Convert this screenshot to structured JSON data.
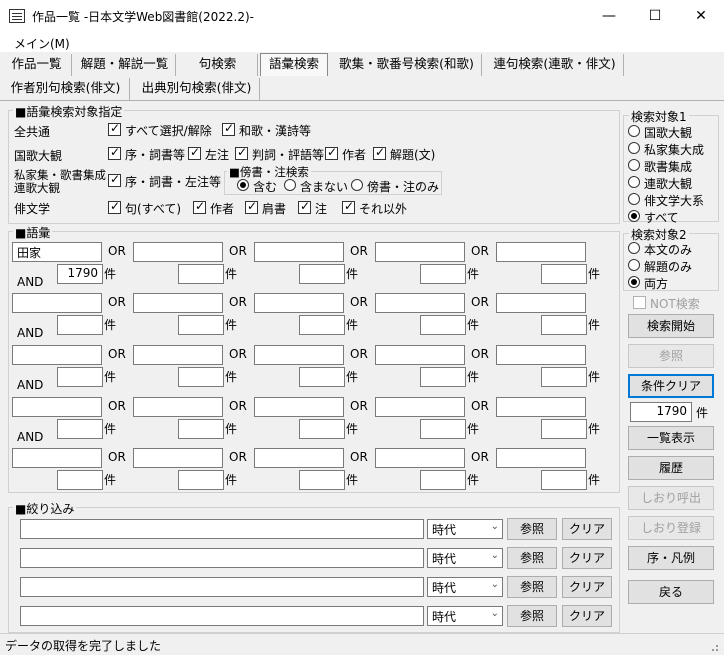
{
  "window": {
    "title": "作品一覧 -日本文学Web図書館(2022.2)-",
    "minimize": "—",
    "maximize": "☐",
    "close": "✕"
  },
  "menu": {
    "main": "メイン(M)"
  },
  "tabs": [
    {
      "label": "作品一覧"
    },
    {
      "label": "解題・解説一覧"
    },
    {
      "label": "句検索"
    },
    {
      "label": "語彙検索"
    },
    {
      "label": "歌集・歌番号検索(和歌)"
    },
    {
      "label": "連句検索(連歌・俳文)"
    },
    {
      "label": "作者別句検索(俳文)"
    },
    {
      "label": "出典別句検索(俳文)"
    }
  ],
  "target_group": {
    "title": "■語彙検索対象指定",
    "rows": [
      {
        "label": "全共通",
        "checks": [
          {
            "label": "すべて選択/解除",
            "checked": true
          },
          {
            "label": "和歌・漢詩等",
            "checked": true
          }
        ]
      },
      {
        "label": "国歌大観",
        "checks": [
          {
            "label": "序・詞書等",
            "checked": true
          },
          {
            "label": "左注",
            "checked": true
          },
          {
            "label": "判詞・評語等",
            "checked": true
          },
          {
            "label": "作者",
            "checked": true
          },
          {
            "label": "解題(文)",
            "checked": true
          }
        ]
      },
      {
        "label_line1": "私家集・歌書集成",
        "label_line2": "連歌大観",
        "checks": [
          {
            "label": "序・詞書・左注等",
            "checked": true
          }
        ]
      },
      {
        "label": "俳文学",
        "checks": [
          {
            "label": "句(すべて)",
            "checked": true
          },
          {
            "label": "作者",
            "checked": true
          },
          {
            "label": "肩書",
            "checked": true
          },
          {
            "label": "注",
            "checked": true
          },
          {
            "label": "それ以外",
            "checked": true
          }
        ]
      }
    ],
    "side_note": {
      "title": "■傍書・注検索",
      "options": [
        {
          "label": "含む",
          "selected": true
        },
        {
          "label": "含まない",
          "selected": false
        },
        {
          "label": "傍書・注のみ",
          "selected": false
        }
      ]
    }
  },
  "vocab_group": {
    "title": "■語彙",
    "or_label": "OR",
    "and_label": "AND",
    "count_unit": "件",
    "rows": [
      {
        "terms": [
          "田家",
          "",
          "",
          "",
          ""
        ],
        "counts": [
          "1790",
          "",
          "",
          "",
          ""
        ]
      },
      {
        "terms": [
          "",
          "",
          "",
          "",
          ""
        ],
        "counts": [
          "",
          "",
          "",
          "",
          ""
        ]
      },
      {
        "terms": [
          "",
          "",
          "",
          "",
          ""
        ],
        "counts": [
          "",
          "",
          "",
          "",
          ""
        ]
      },
      {
        "terms": [
          "",
          "",
          "",
          "",
          ""
        ],
        "counts": [
          "",
          "",
          "",
          "",
          ""
        ]
      },
      {
        "terms": [
          "",
          "",
          "",
          "",
          ""
        ],
        "counts": [
          "",
          "",
          "",
          "",
          ""
        ]
      }
    ]
  },
  "filter_group": {
    "title": "■絞り込み",
    "rows": [
      {
        "value": "",
        "combo": "時代",
        "ref": "参照",
        "clear": "クリア"
      },
      {
        "value": "",
        "combo": "時代",
        "ref": "参照",
        "clear": "クリア"
      },
      {
        "value": "",
        "combo": "時代",
        "ref": "参照",
        "clear": "クリア"
      },
      {
        "value": "",
        "combo": "時代",
        "ref": "参照",
        "clear": "クリア"
      }
    ]
  },
  "search_target1": {
    "title": "検索対象1",
    "options": [
      {
        "label": "国歌大観",
        "selected": false
      },
      {
        "label": "私家集大成",
        "selected": false
      },
      {
        "label": "歌書集成",
        "selected": false
      },
      {
        "label": "連歌大観",
        "selected": false
      },
      {
        "label": "俳文学大系",
        "selected": false
      },
      {
        "label": "すべて",
        "selected": true
      }
    ]
  },
  "search_target2": {
    "title": "検索対象2",
    "options": [
      {
        "label": "本文のみ",
        "selected": false
      },
      {
        "label": "解題のみ",
        "selected": false
      },
      {
        "label": "両方",
        "selected": true
      }
    ]
  },
  "side": {
    "not_search": "NOT検索",
    "search_start": "検索開始",
    "reference": "参照",
    "condition_clear": "条件クリア",
    "total_count": "1790",
    "count_unit": "件",
    "list_display": "一覧表示",
    "history": "履歴",
    "bookmark_load": "しおり呼出",
    "bookmark_save": "しおり登録",
    "preface": "序・凡例",
    "back": "戻る"
  },
  "status": {
    "text": "データの取得を完了しました"
  }
}
